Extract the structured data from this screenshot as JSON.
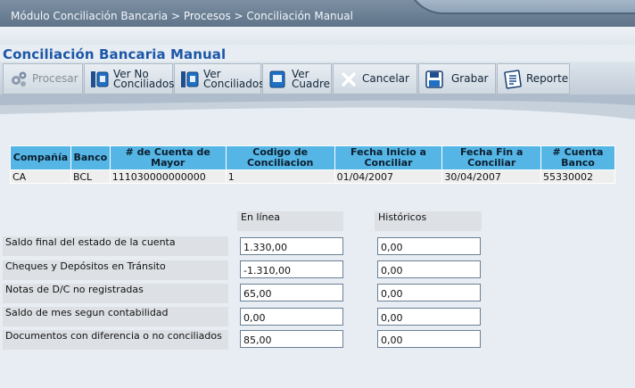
{
  "breadcrumb": "Módulo Conciliación Bancaria > Procesos > Conciliación Manual",
  "page_title": "Conciliación Bancaria Manual",
  "toolbar": {
    "procesar": "Procesar",
    "ver_no_conciliados_1": "Ver No",
    "ver_no_conciliados_2": "Conciliados",
    "ver_conciliados_1": "Ver",
    "ver_conciliados_2": "Conciliados",
    "ver_cuadre_1": "Ver",
    "ver_cuadre_2": "Cuadre",
    "cancelar": "Cancelar",
    "grabar": "Grabar",
    "reporte": "Reporte"
  },
  "table": {
    "headers": [
      "Compañía",
      "Banco",
      "# de Cuenta de Mayor",
      "Codigo de Conciliacion",
      "Fecha Inicio a Conciliar",
      "Fecha Fin a Conciliar",
      "# Cuenta Banco"
    ],
    "rows": [
      [
        "CA",
        "BCL",
        "111030000000000",
        "1",
        "01/04/2007",
        "30/04/2007",
        "55330002"
      ]
    ]
  },
  "summary": {
    "col_en_linea": "En línea",
    "col_historicos": "Históricos",
    "rows": [
      {
        "label": "Saldo final del estado de la cuenta",
        "en_linea": "1.330,00",
        "historico": "0,00"
      },
      {
        "label": "Cheques y Depósitos en Tránsito",
        "en_linea": "-1.310,00",
        "historico": "0,00"
      },
      {
        "label": "Notas de D/C no registradas",
        "en_linea": "65,00",
        "historico": "0,00"
      },
      {
        "label": "Saldo de mes segun contabilidad",
        "en_linea": "0,00",
        "historico": "0,00"
      },
      {
        "label": "Documentos con diferencia o no conciliados",
        "en_linea": "85,00",
        "historico": "0,00"
      }
    ]
  }
}
